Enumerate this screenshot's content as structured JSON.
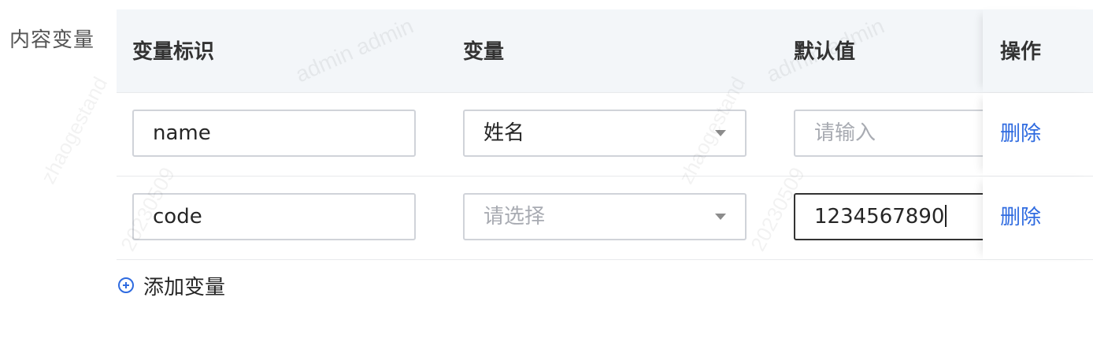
{
  "form": {
    "label": "内容变量"
  },
  "table": {
    "columns": {
      "key": "变量标识",
      "variable": "变量",
      "default": "默认值",
      "action": "操作"
    },
    "rows": [
      {
        "key_value": "name",
        "variable_value": "姓名",
        "default_value": "",
        "default_placeholder": "请输入",
        "action": "删除"
      },
      {
        "key_value": "code",
        "variable_value": "",
        "variable_placeholder": "请选择",
        "default_value": "1234567890",
        "action": "删除"
      }
    ]
  },
  "add_button": {
    "label": "添加变量"
  },
  "watermark": {
    "user": "admin admin",
    "account": "zhaogestand",
    "date": "20230509"
  }
}
